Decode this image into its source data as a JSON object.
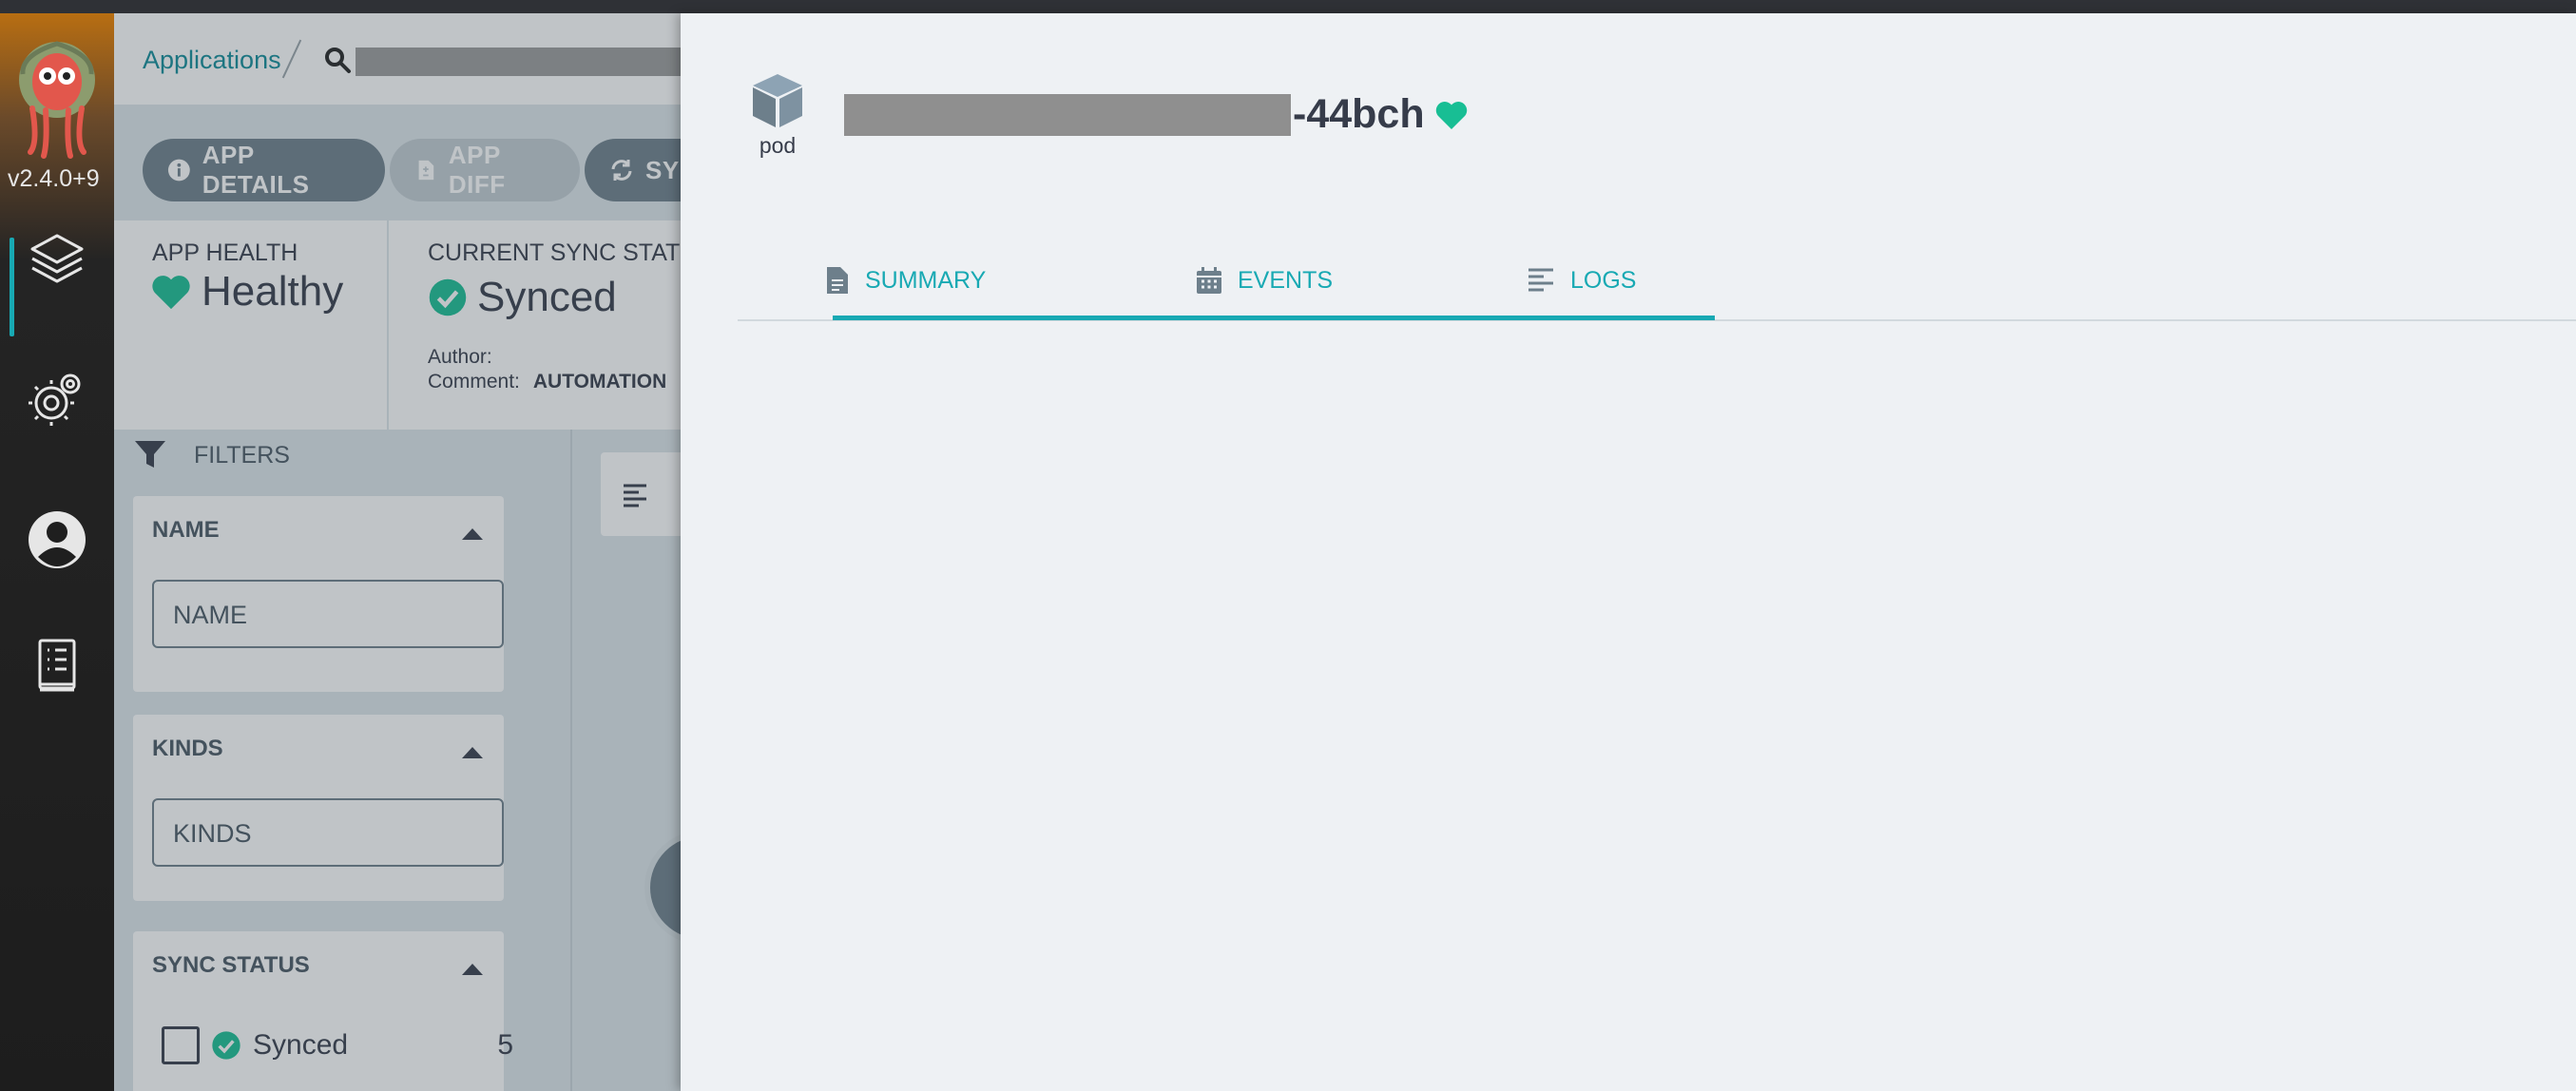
{
  "nav": {
    "version": "v2.4.0+9",
    "items": [
      "applications",
      "settings",
      "user-info",
      "docs"
    ]
  },
  "breadcrumb": {
    "applications": "Applications"
  },
  "toolbar": {
    "app_details": "APP DETAILS",
    "app_diff": "APP DIFF",
    "sync": "SYNC"
  },
  "status": {
    "health_label": "APP HEALTH",
    "health_value": "Healthy",
    "sync_label": "CURRENT SYNC STATUS",
    "sync_value": "Synced",
    "author_label": "Author:",
    "comment_label": "Comment:",
    "comment_value": "AUTOMATION"
  },
  "filters": {
    "title": "FILTERS",
    "name": {
      "title": "NAME",
      "placeholder": "NAME"
    },
    "kinds": {
      "title": "KINDS",
      "placeholder": "KINDS"
    },
    "sync_status": {
      "title": "SYNC STATUS",
      "option": "Synced",
      "count": "5"
    }
  },
  "panel": {
    "kind": "pod",
    "name_suffix": "-44bch",
    "tabs": [
      {
        "label": "SUMMARY",
        "icon": "file-text-icon"
      },
      {
        "label": "EVENTS",
        "icon": "calendar-icon"
      },
      {
        "label": "LOGS",
        "icon": "align-left-icon"
      }
    ],
    "active_tab": "SUMMARY"
  },
  "colors": {
    "accent": "#18a9b3",
    "healthy": "#18be94",
    "text": "#363c4a"
  }
}
